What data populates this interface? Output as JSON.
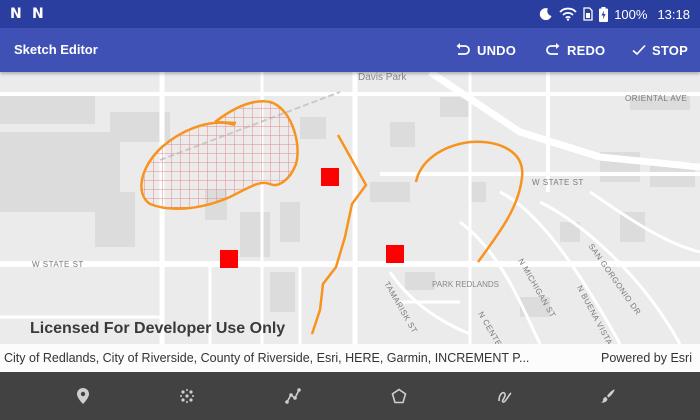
{
  "status_bar": {
    "left_icons": [
      "n-notification-icon",
      "n-notification-icon"
    ],
    "battery": "100%",
    "time": "13:18"
  },
  "action_bar": {
    "title": "Sketch Editor",
    "undo_label": "UNDO",
    "redo_label": "REDO",
    "stop_label": "STOP"
  },
  "map": {
    "places": [
      "Davis Park",
      "PARK REDLANDS"
    ],
    "streets": [
      "ORIENTAL AVE",
      "W STATE ST",
      "W STATE ST",
      "SAN GORGONIO DR",
      "N MICHIGAN ST",
      "N BUENA VISTA ST",
      "TAMARISK ST",
      "N CENTER"
    ],
    "license": "Licensed For Developer Use Only",
    "sketch_color": "#f7931e",
    "point_color": "#ff0000"
  },
  "attribution": {
    "text": "City of Redlands, City of Riverside, County of Riverside, Esri, HERE, Garmin, INCREMENT P...",
    "powered_by": "Powered by Esri"
  },
  "toolbar": {
    "tools": [
      "point-tool-icon",
      "multipoint-tool-icon",
      "polyline-tool-icon",
      "polygon-tool-icon",
      "freehand-line-tool-icon",
      "freehand-polygon-tool-icon"
    ]
  }
}
